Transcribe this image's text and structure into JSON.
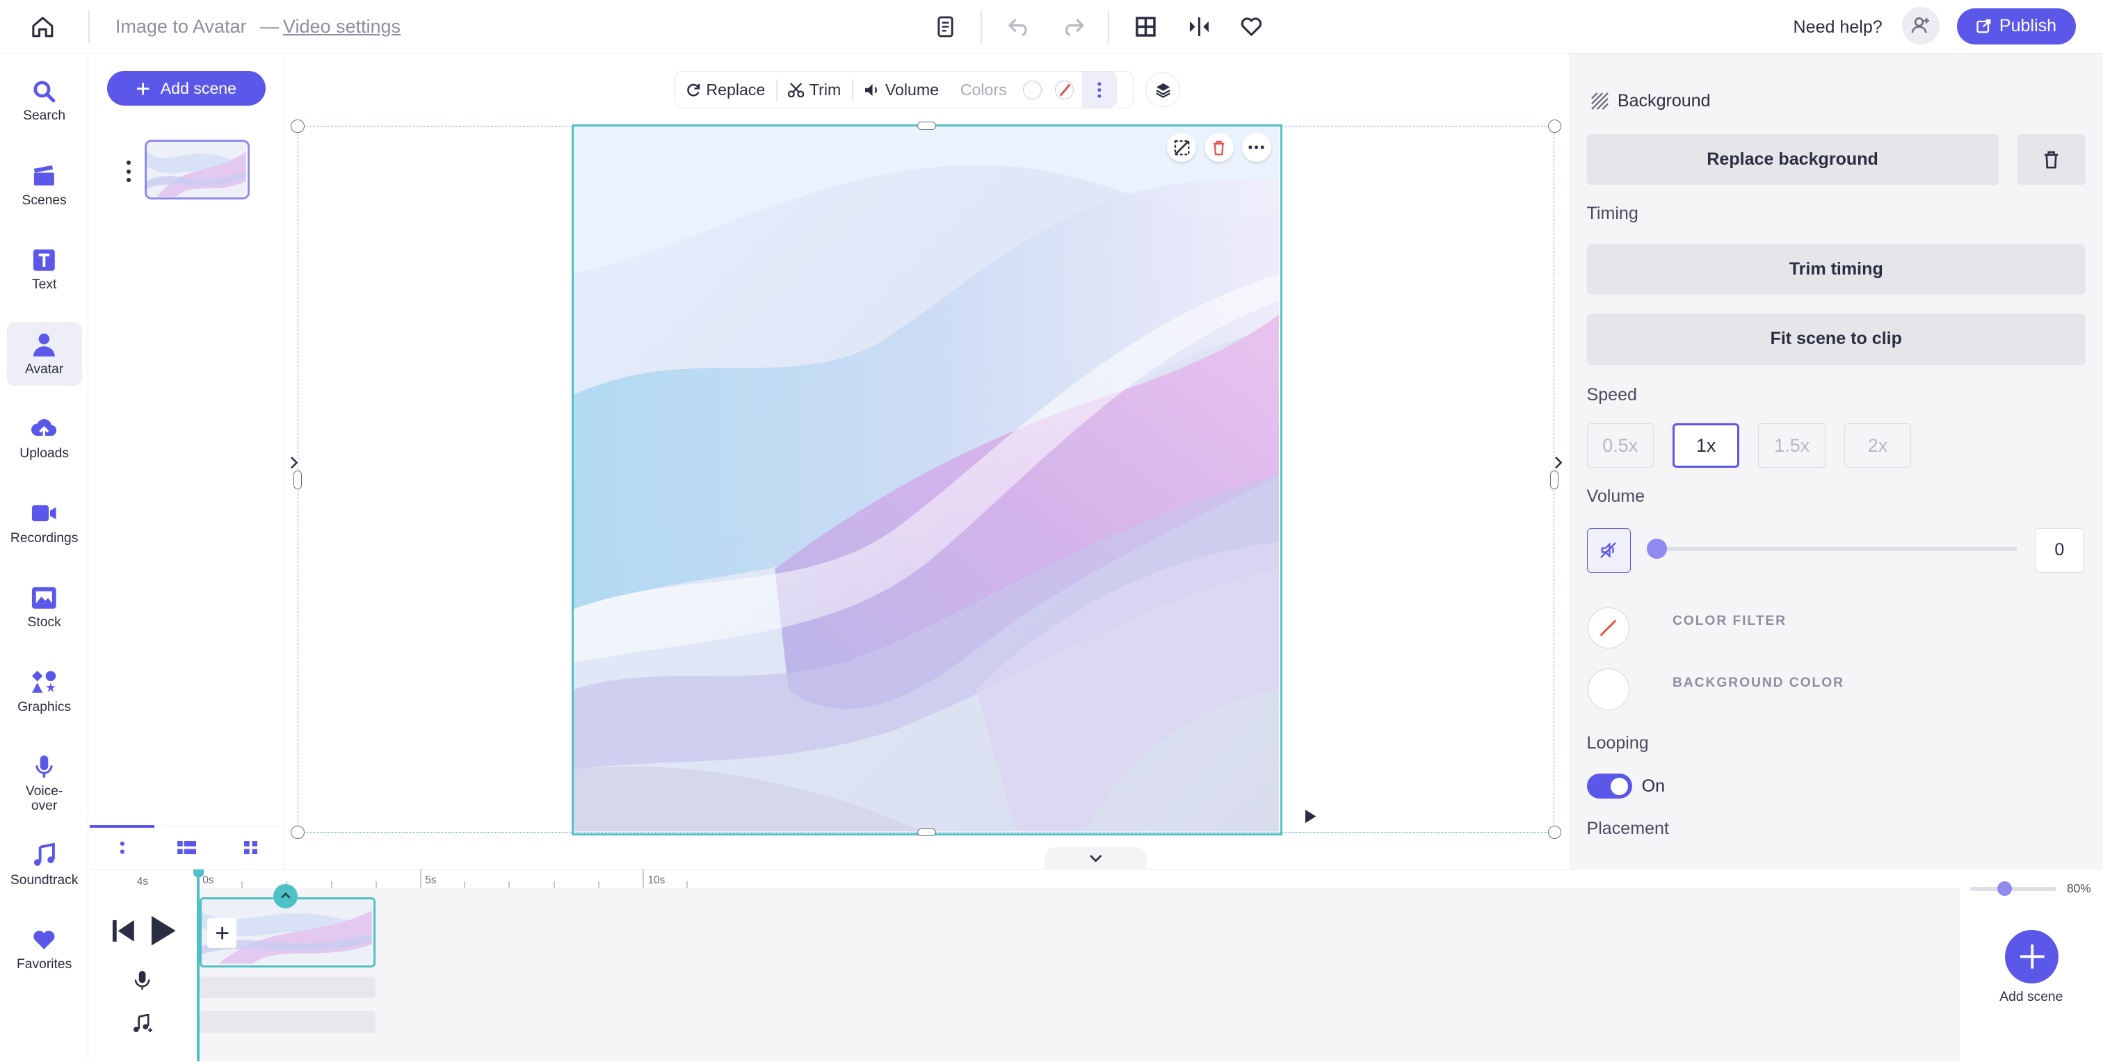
{
  "header": {
    "project_title": "Image to Avatar",
    "separator": "—",
    "settings_link": "Video settings",
    "help_label": "Need help?",
    "publish_label": "Publish"
  },
  "rail": {
    "items": [
      {
        "label": "Search",
        "icon": "search-icon"
      },
      {
        "label": "Scenes",
        "icon": "clapperboard-icon"
      },
      {
        "label": "Text",
        "icon": "text-icon"
      },
      {
        "label": "Avatar",
        "icon": "person-icon",
        "active": true
      },
      {
        "label": "Uploads",
        "icon": "cloud-upload-icon"
      },
      {
        "label": "Recordings",
        "icon": "video-camera-icon"
      },
      {
        "label": "Stock",
        "icon": "stock-images-icon"
      },
      {
        "label": "Graphics",
        "icon": "shapes-icon"
      },
      {
        "label": "Voice-over",
        "icon": "microphone-icon"
      },
      {
        "label": "Soundtrack",
        "icon": "music-note-icon"
      },
      {
        "label": "Favorites",
        "icon": "heart-icon"
      }
    ]
  },
  "scenes_panel": {
    "add_scene_label": "Add scene"
  },
  "canvas_toolbar": {
    "replace_label": "Replace",
    "trim_label": "Trim",
    "volume_label": "Volume",
    "colors_label": "Colors"
  },
  "properties": {
    "background_heading": "Background",
    "replace_background_label": "Replace background",
    "timing_label": "Timing",
    "trim_timing_label": "Trim timing",
    "fit_scene_label": "Fit scene to clip",
    "speed_label": "Speed",
    "speed_options": [
      "0.5x",
      "1x",
      "1.5x",
      "2x"
    ],
    "speed_selected": "1x",
    "volume_label": "Volume",
    "volume_value": "0",
    "color_filter_label": "COLOR FILTER",
    "background_color_label": "BACKGROUND COLOR",
    "looping_label": "Looping",
    "looping_state": "On",
    "placement_label": "Placement"
  },
  "timeline": {
    "duration_label": "4s",
    "ticks": [
      "0s",
      "5s",
      "10s"
    ],
    "zoom_label": "80%",
    "add_scene_label": "Add scene"
  },
  "colors": {
    "accent": "#5b57e8",
    "selection": "#4fc1c6",
    "panel_bg": "#f5f5f7"
  }
}
